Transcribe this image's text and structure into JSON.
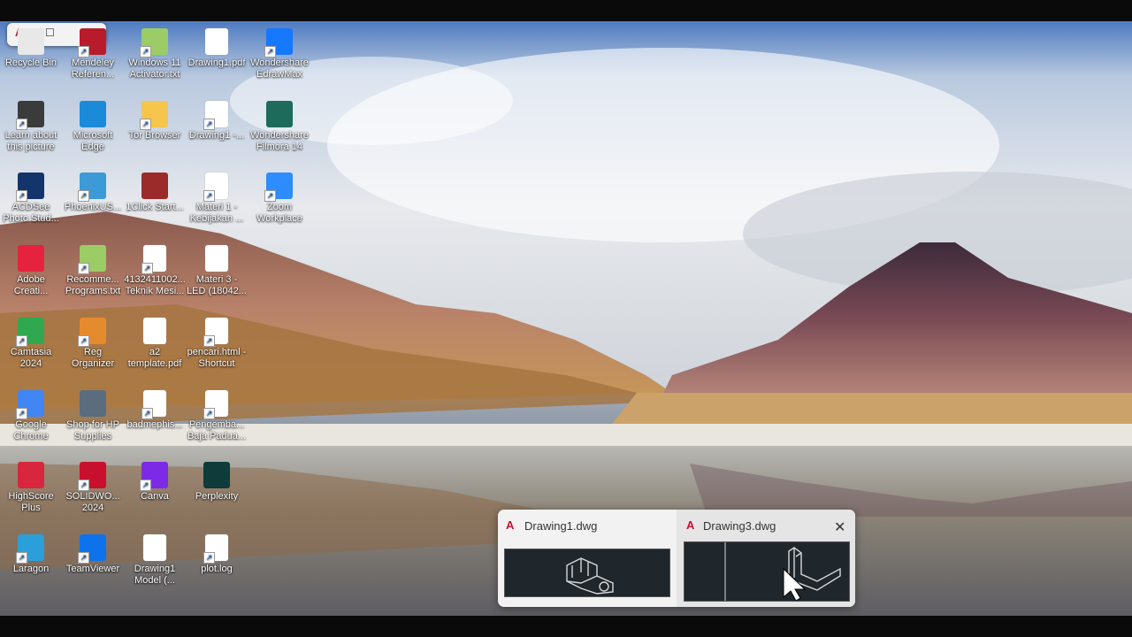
{
  "mini_window": {
    "logo": "A",
    "maximize": "☐",
    "close": "✕"
  },
  "desktop_icons": [
    {
      "label": "Recycle Bin",
      "color": "#e8e8e8"
    },
    {
      "label": "Mendeley Referen...",
      "color": "#b81c2a"
    },
    {
      "label": "Windows 11 Activator.txt",
      "color": "#9ccc65"
    },
    {
      "label": "Drawing1.pdf",
      "color": "#ffffff"
    },
    {
      "label": "Wondershare EdrawMax",
      "color": "#1677ff"
    },
    {
      "label": "Learn about this picture",
      "color": "#3b3b3b"
    },
    {
      "label": "Microsoft Edge",
      "color": "#1b8ad8"
    },
    {
      "label": "Tor Browser",
      "color": "#f6c54b"
    },
    {
      "label": "Drawing1 -...",
      "color": "#ffffff"
    },
    {
      "label": "Wondershare Filmora 14",
      "color": "#1d6b5a"
    },
    {
      "label": "ACDSee Photo Stud...",
      "color": "#14356b"
    },
    {
      "label": "PhoenixUS...",
      "color": "#3c9ad6"
    },
    {
      "label": "1Click Start...",
      "color": "#9b2a2a"
    },
    {
      "label": "Materi 1 - Kebijakan ...",
      "color": "#ffffff"
    },
    {
      "label": "Zoom Workplace",
      "color": "#2d8cff"
    },
    {
      "label": "Adobe Creati...",
      "color": "#e5233f"
    },
    {
      "label": "Recomme... Programs.txt",
      "color": "#9ccc65"
    },
    {
      "label": "4132411002... Teknik Mesi...",
      "color": "#ffffff"
    },
    {
      "label": "Materi 3 - LED (18042...",
      "color": "#ffffff"
    },
    {
      "label": "Camtasia 2024",
      "color": "#2fa84f"
    },
    {
      "label": "Reg Organizer",
      "color": "#e68a2e"
    },
    {
      "label": "a2 template.pdf",
      "color": "#ffffff"
    },
    {
      "label": "pencari.html - Shortcut",
      "color": "#ffffff"
    },
    {
      "label": "Google Chrome",
      "color": "#4285f4"
    },
    {
      "label": "Shop for HP Supplies",
      "color": "#5a6c7d"
    },
    {
      "label": "badmephis...",
      "color": "#ffffff"
    },
    {
      "label": "Pengemba... Baja Padua...",
      "color": "#ffffff"
    },
    {
      "label": "HighScore Plus",
      "color": "#d7263d"
    },
    {
      "label": "SOLIDWO... 2024",
      "color": "#c8102e"
    },
    {
      "label": "Canva",
      "color": "#7d2ae8"
    },
    {
      "label": "Perplexity",
      "color": "#0f3b3b"
    },
    {
      "label": "Laragon",
      "color": "#2b9fd9"
    },
    {
      "label": "TeamViewer",
      "color": "#0e72ed"
    },
    {
      "label": "Drawing1 Model (...",
      "color": "#ffffff"
    },
    {
      "label": "plot.log",
      "color": "#ffffff"
    }
  ],
  "taskbar_preview": {
    "thumbnails": [
      {
        "title": "Drawing1.dwg",
        "logo": "A"
      },
      {
        "title": "Drawing3.dwg",
        "logo": "A",
        "close": "✕"
      }
    ]
  }
}
